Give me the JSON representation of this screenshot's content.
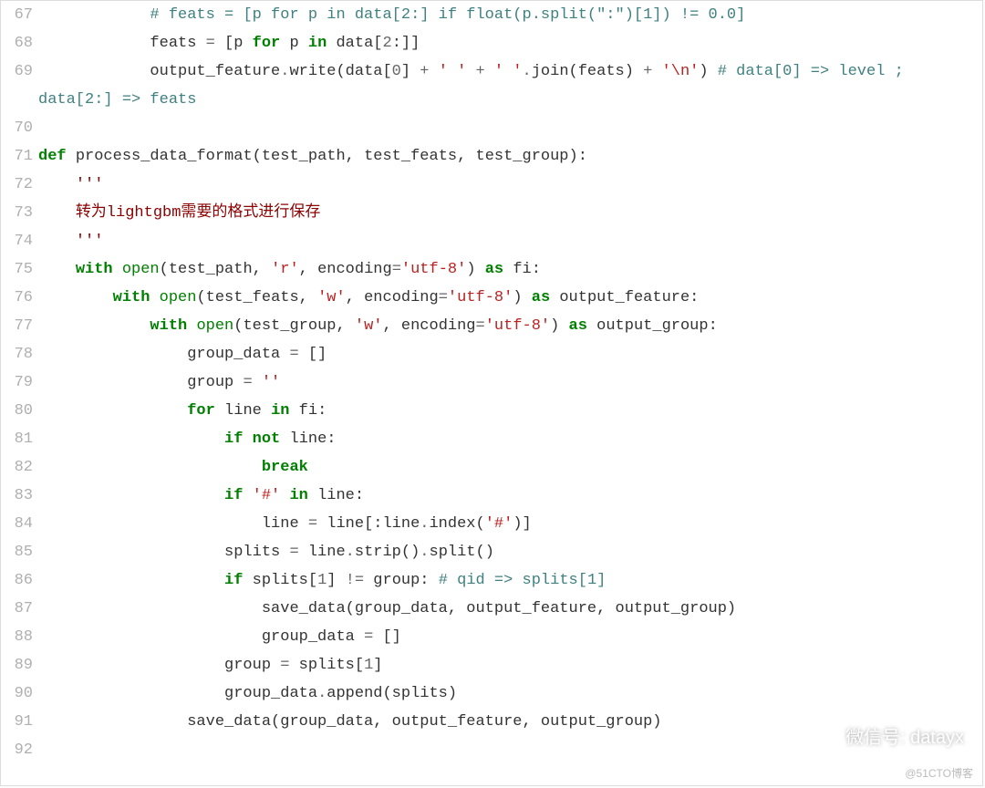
{
  "lines": [
    {
      "n": 67,
      "html": "            <span class='c-comment'># feats = [p for p in data[2:] if float(p.split(\":\")[1]) != 0.0]</span>"
    },
    {
      "n": 68,
      "html": "            feats <span class='c-op'>=</span> [p <span class='c-keyword'>for</span> p <span class='c-keyword'>in</span> data[<span class='c-num'>2</span>:]]"
    },
    {
      "n": 69,
      "html": "            output_feature<span class='c-op'>.</span>write(data[<span class='c-num'>0</span>] <span class='c-op'>+</span> <span class='c-string'>' '</span> <span class='c-op'>+</span> <span class='c-string'>' '</span><span class='c-op'>.</span>join(feats) <span class='c-op'>+</span> <span class='c-string'>'\\n'</span>) <span class='c-comment'># data[0] => level ;</span>",
      "wrap": "<span class='c-comment'>data[2:] => feats</span>"
    },
    {
      "n": 70,
      "html": ""
    },
    {
      "n": 71,
      "html": "<span class='c-keyword'>def</span> <span class='c-text'>process_data_format</span>(test_path, test_feats, test_group):"
    },
    {
      "n": 72,
      "html": "    <span class='c-docstr'>'''</span>"
    },
    {
      "n": 73,
      "html": "    <span class='c-docstr'>转为lightgbm需要的格式进行保存</span>"
    },
    {
      "n": 74,
      "html": "    <span class='c-docstr'>'''</span>"
    },
    {
      "n": 75,
      "html": "    <span class='c-keyword'>with</span> <span class='c-kw2'>open</span>(test_path, <span class='c-string'>'r'</span>, encoding<span class='c-op'>=</span><span class='c-string'>'utf-8'</span>) <span class='c-keyword'>as</span> fi:"
    },
    {
      "n": 76,
      "html": "        <span class='c-keyword'>with</span> <span class='c-kw2'>open</span>(test_feats, <span class='c-string'>'w'</span>, encoding<span class='c-op'>=</span><span class='c-string'>'utf-8'</span>) <span class='c-keyword'>as</span> output_feature:"
    },
    {
      "n": 77,
      "html": "            <span class='c-keyword'>with</span> <span class='c-kw2'>open</span>(test_group, <span class='c-string'>'w'</span>, encoding<span class='c-op'>=</span><span class='c-string'>'utf-8'</span>) <span class='c-keyword'>as</span> output_group:"
    },
    {
      "n": 78,
      "html": "                group_data <span class='c-op'>=</span> []"
    },
    {
      "n": 79,
      "html": "                group <span class='c-op'>=</span> <span class='c-string'>''</span>"
    },
    {
      "n": 80,
      "html": "                <span class='c-keyword'>for</span> line <span class='c-keyword'>in</span> fi:"
    },
    {
      "n": 81,
      "html": "                    <span class='c-keyword'>if</span> <span class='c-keyword'>not</span> line:"
    },
    {
      "n": 82,
      "html": "                        <span class='c-keyword'>break</span>"
    },
    {
      "n": 83,
      "html": "                    <span class='c-keyword'>if</span> <span class='c-string'>'#'</span> <span class='c-keyword'>in</span> line:"
    },
    {
      "n": 84,
      "html": "                        line <span class='c-op'>=</span> line[:line<span class='c-op'>.</span>index(<span class='c-string'>'#'</span>)]"
    },
    {
      "n": 85,
      "html": "                    splits <span class='c-op'>=</span> line<span class='c-op'>.</span>strip()<span class='c-op'>.</span>split()"
    },
    {
      "n": 86,
      "html": "                    <span class='c-keyword'>if</span> splits[<span class='c-num'>1</span>] <span class='c-op'>!=</span> group: <span class='c-comment'># qid => splits[1]</span>"
    },
    {
      "n": 87,
      "html": "                        save_data(group_data, output_feature, output_group)"
    },
    {
      "n": 88,
      "html": "                        group_data <span class='c-op'>=</span> []"
    },
    {
      "n": 89,
      "html": "                    group <span class='c-op'>=</span> splits[<span class='c-num'>1</span>]"
    },
    {
      "n": 90,
      "html": "                    group_data<span class='c-op'>.</span>append(splits)"
    },
    {
      "n": 91,
      "html": "                save_data(group_data, output_feature, output_group)"
    },
    {
      "n": 92,
      "html": ""
    }
  ],
  "watermark": {
    "label": "微信号: datayx"
  },
  "footer": {
    "label": "@51CTO博客"
  }
}
